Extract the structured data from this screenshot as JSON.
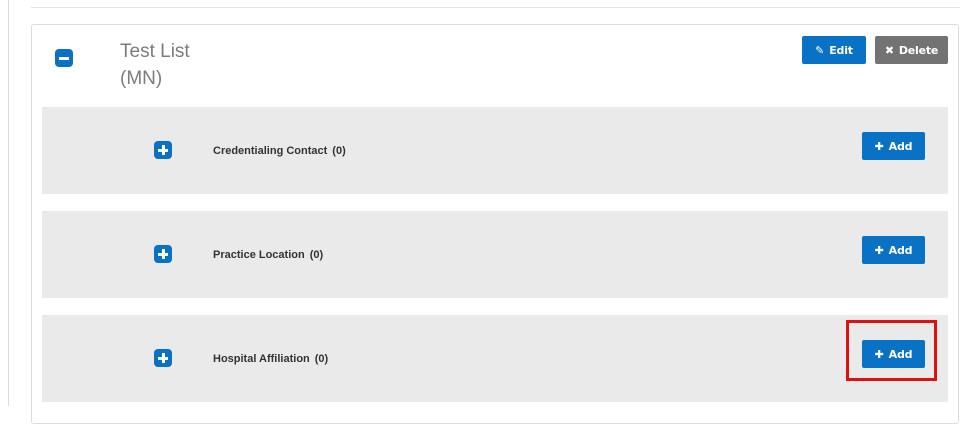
{
  "list": {
    "title": "Test List (MN)",
    "edit_label": "Edit",
    "delete_label": "Delete"
  },
  "rows": [
    {
      "label": "Credentialing Contact",
      "count": "(0)",
      "add_label": "Add"
    },
    {
      "label": "Practice Location",
      "count": "(0)",
      "add_label": "Add"
    },
    {
      "label": "Hospital Affiliation",
      "count": "(0)",
      "add_label": "Add"
    }
  ],
  "icons": {
    "collapse": "minus-square-icon",
    "expand": "plus-square-icon",
    "edit": "pencil-square-icon",
    "delete": "x-icon",
    "add": "plus-icon"
  },
  "colors": {
    "primary": "#0a72c4",
    "secondary": "#737373",
    "row_bg": "#eaeaea",
    "highlight": "#e01010"
  }
}
